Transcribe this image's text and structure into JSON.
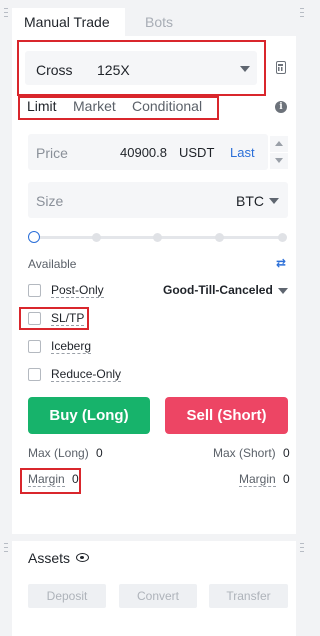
{
  "tabs": {
    "manual_trade": "Manual Trade",
    "bots": "Bots"
  },
  "leverage": {
    "mode": "Cross",
    "value": "125X"
  },
  "order_types": [
    "Limit",
    "Market",
    "Conditional"
  ],
  "price": {
    "label": "Price",
    "value": "40900.8",
    "unit": "USDT",
    "last": "Last"
  },
  "size": {
    "label": "Size",
    "unit": "BTC"
  },
  "slider": {
    "level_percent": 0
  },
  "available": {
    "label": "Available"
  },
  "options": {
    "post_only": "Post-Only",
    "time_in_force": "Good-Till-Canceled",
    "sl_tp": "SL/TP",
    "iceberg": "Iceberg",
    "reduce_only": "Reduce-Only"
  },
  "actions": {
    "buy": "Buy (Long)",
    "sell": "Sell (Short)"
  },
  "stats": {
    "max_long_label": "Max (Long)",
    "max_long_value": "0",
    "max_short_label": "Max (Short)",
    "max_short_value": "0",
    "margin_left_label": "Margin",
    "margin_left_value": "0",
    "margin_right_label": "Margin",
    "margin_right_value": "0"
  },
  "assets": {
    "title": "Assets",
    "deposit": "Deposit",
    "convert": "Convert",
    "transfer": "Transfer"
  },
  "colors": {
    "buy": "#17b36b",
    "sell": "#ed4564",
    "accent": "#2b6fd8",
    "highlight": "#d9262c"
  }
}
